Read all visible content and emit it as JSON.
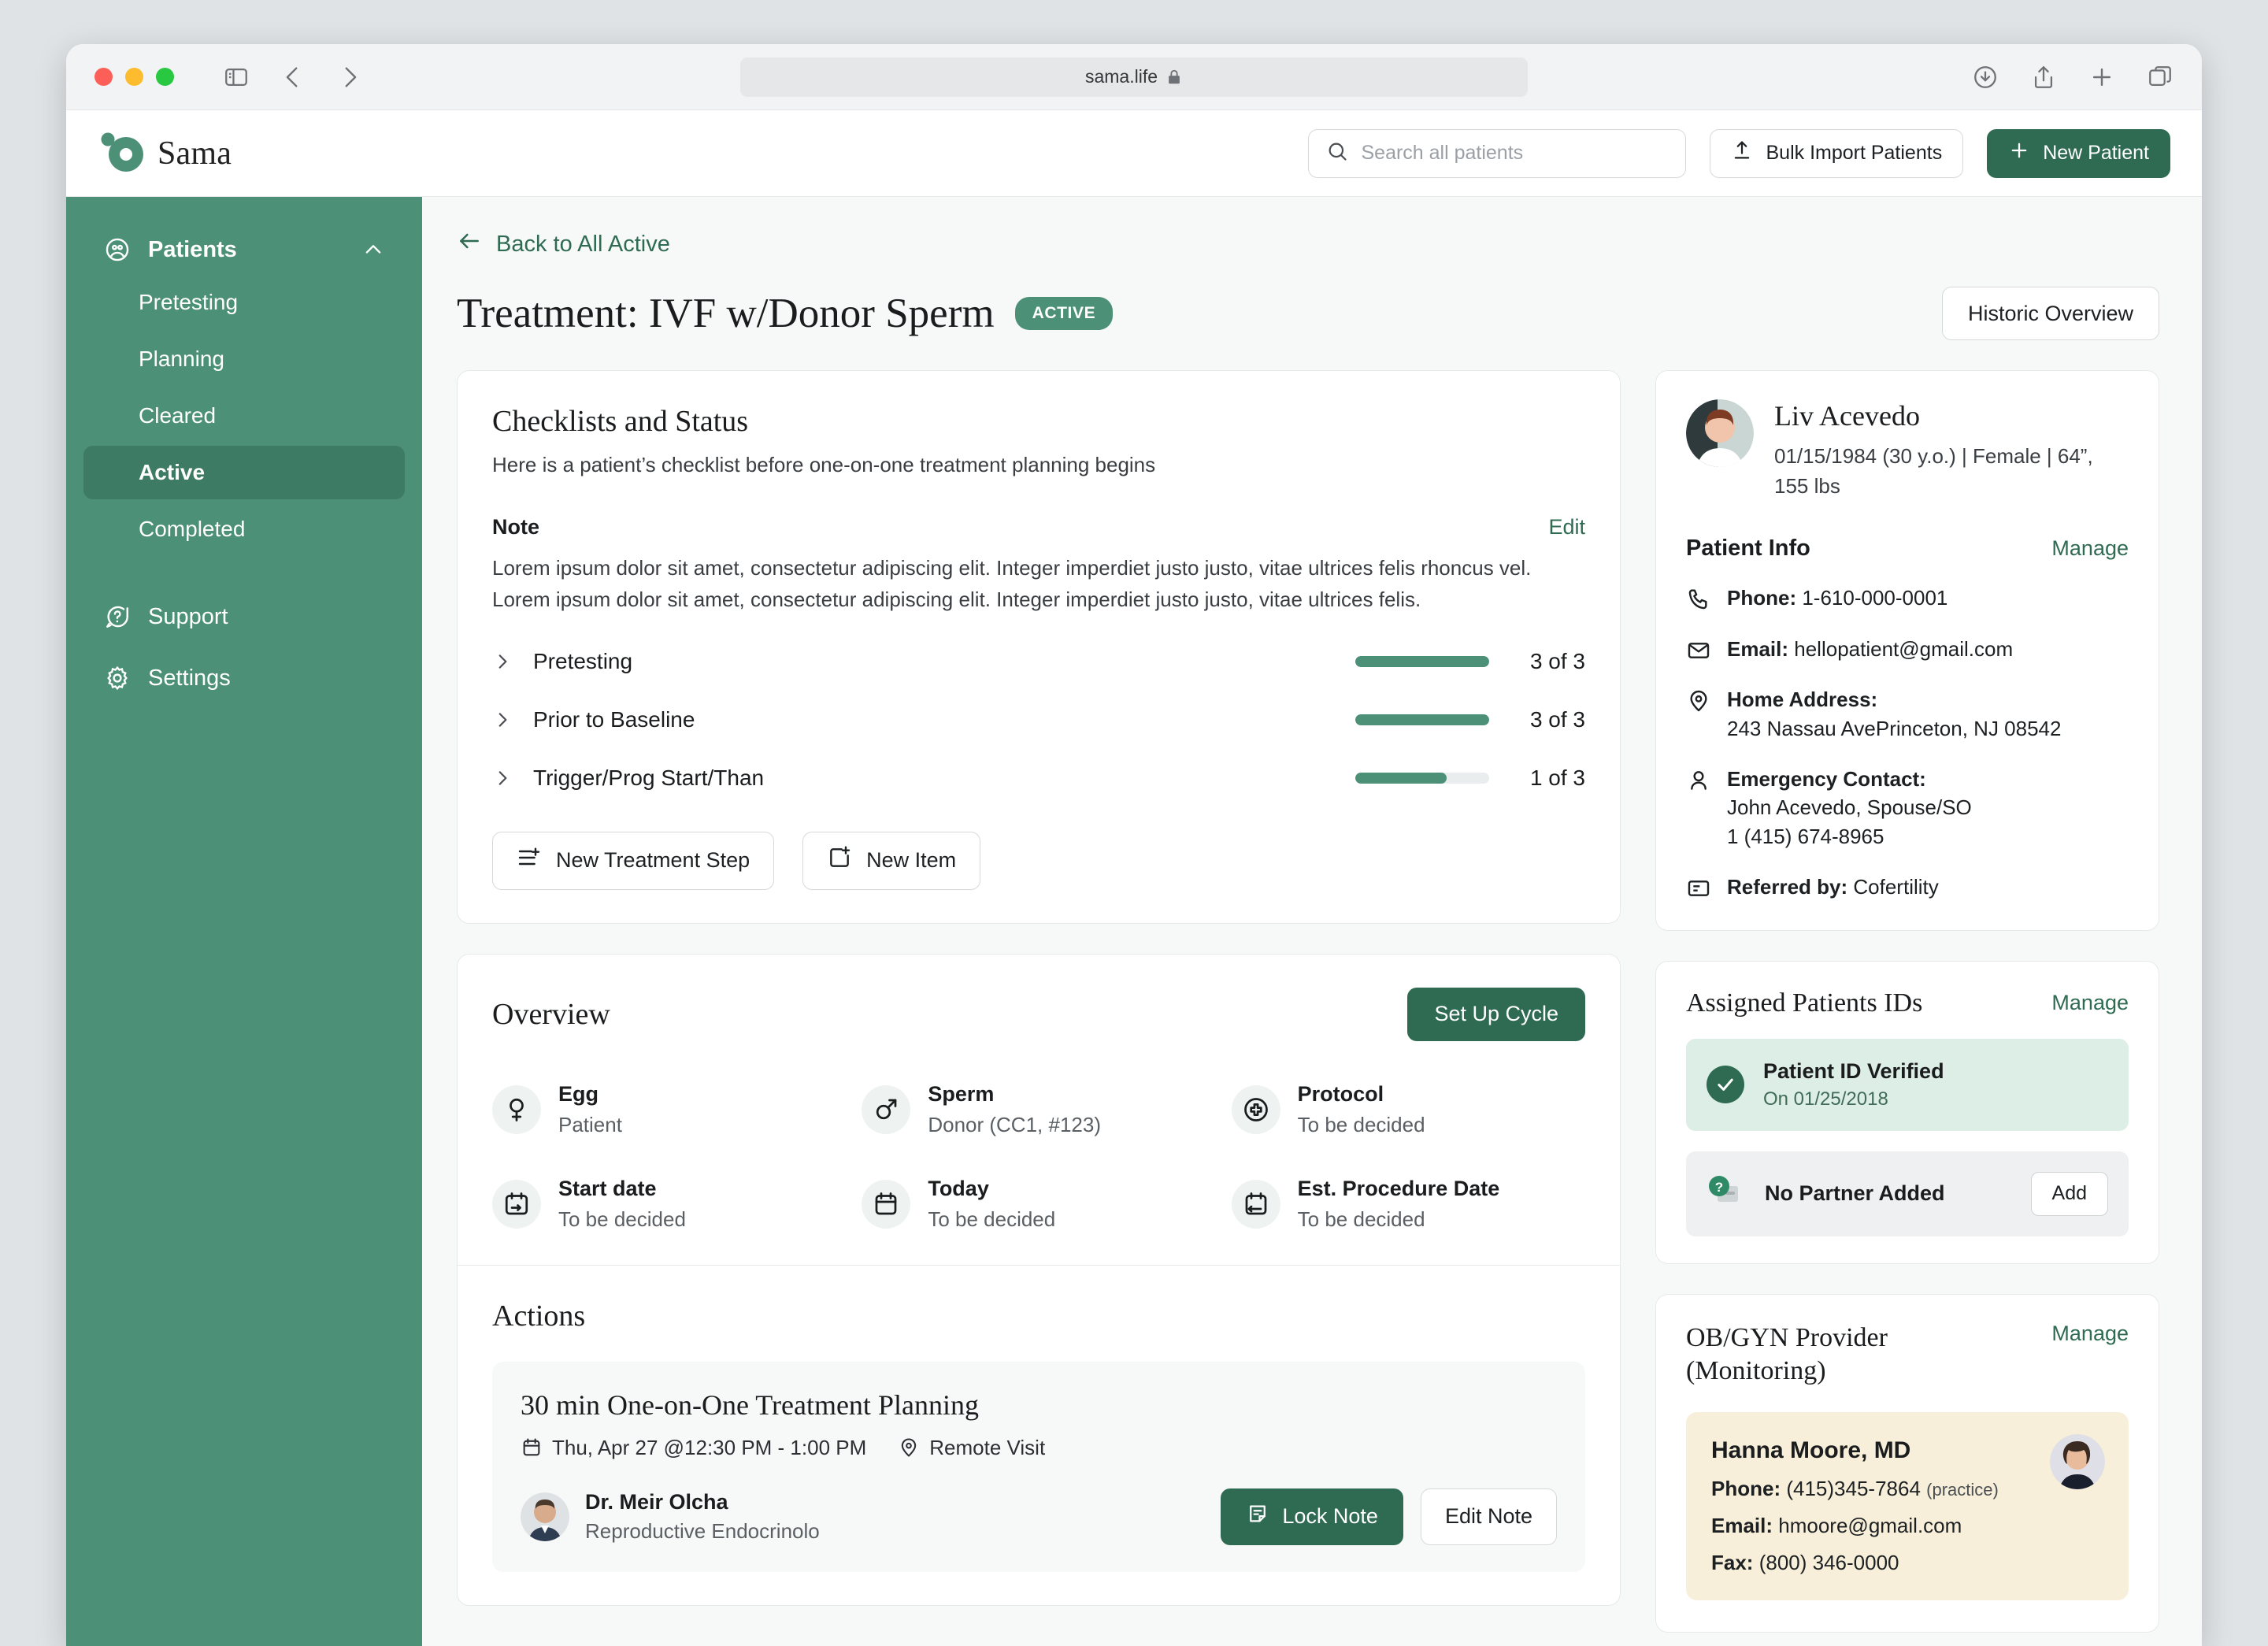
{
  "browser": {
    "url": "sama.life",
    "lock_icon": "lock-icon"
  },
  "app": {
    "brand": "Sama",
    "search": {
      "placeholder": "Search all patients",
      "value": ""
    },
    "bulk_import_label": "Bulk Import Patients",
    "new_patient_label": "New Patient"
  },
  "sidebar": {
    "group": {
      "label": "Patients",
      "icon": "users-icon",
      "chevron": "chevron-up-icon"
    },
    "sub_items": [
      {
        "label": "Pretesting",
        "active": false
      },
      {
        "label": "Planning",
        "active": false
      },
      {
        "label": "Cleared",
        "active": false
      },
      {
        "label": "Active",
        "active": true
      },
      {
        "label": "Completed",
        "active": false
      }
    ],
    "items": [
      {
        "label": "Support",
        "icon": "help-icon"
      },
      {
        "label": "Settings",
        "icon": "gear-icon"
      }
    ]
  },
  "page": {
    "back_label": "Back to All Active",
    "title": "Treatment: IVF w/Donor Sperm",
    "status_badge": "ACTIVE",
    "historic_overview_label": "Historic Overview"
  },
  "checklists": {
    "heading": "Checklists and Status",
    "subheading": "Here is a patient’s checklist before one-on-one treatment planning begins",
    "note_label": "Note",
    "note_edit_label": "Edit",
    "note_body": "Lorem ipsum dolor sit amet, consectetur adipiscing elit. Integer imperdiet justo justo, vitae ultrices felis rhoncus vel. Lorem ipsum dolor sit amet, consectetur adipiscing elit. Integer imperdiet justo justo, vitae ultrices felis.",
    "rows": [
      {
        "label": "Pretesting",
        "count": "3 of 3",
        "percent": 100
      },
      {
        "label": "Prior to Baseline",
        "count": "3 of 3",
        "percent": 100
      },
      {
        "label": "Trigger/Prog Start/Than",
        "count": "1 of 3",
        "percent": 68
      }
    ],
    "new_step_label": "New Treatment Step",
    "new_item_label": "New Item"
  },
  "overview": {
    "heading": "Overview",
    "setup_cycle_label": "Set Up Cycle",
    "items": [
      {
        "icon": "female-icon",
        "label": "Egg",
        "value": "Patient"
      },
      {
        "icon": "male-icon",
        "label": "Sperm",
        "value": "Donor (CC1, #123)"
      },
      {
        "icon": "protocol-icon",
        "label": "Protocol",
        "value": "To be decided"
      },
      {
        "icon": "calendar-start-icon",
        "label": "Start date",
        "value": "To be decided"
      },
      {
        "icon": "calendar-icon",
        "label": "Today",
        "value": "To be decided"
      },
      {
        "icon": "calendar-repeat-icon",
        "label": "Est. Procedure Date",
        "value": "To be decided"
      }
    ]
  },
  "actions": {
    "heading": "Actions",
    "appointment": {
      "title": "30 min One-on-One Treatment Planning",
      "date": "Thu, Apr 27 @12:30 PM - 1:00 PM",
      "location": "Remote Visit",
      "provider_name": "Dr. Meir Olcha",
      "provider_role": "Reproductive Endocrinolo",
      "lock_note_label": "Lock Note",
      "edit_note_label": "Edit Note"
    }
  },
  "patient": {
    "name": "Liv Acevedo",
    "meta": "01/15/1984 (30 y.o.) | Female | 64”, 155 lbs",
    "info_title": "Patient Info",
    "manage_label": "Manage",
    "phone_label": "Phone:",
    "phone_value": "1-610-000-0001",
    "email_label": "Email:",
    "email_value": "hellopatient@gmail.com",
    "address_label": "Home Address:",
    "address_value": "243 Nassau AvePrinceton, NJ 08542",
    "emergency_label": "Emergency Contact:",
    "emergency_name": "John Acevedo, Spouse/SO",
    "emergency_phone": "1 (415) 674-8965",
    "referred_label": "Referred by:",
    "referred_value": "Cofertility"
  },
  "assigned_ids": {
    "title": "Assigned Patients IDs",
    "manage_label": "Manage",
    "verified_title": "Patient ID Verified",
    "verified_sub": "On 01/25/2018",
    "no_partner_title": "No Partner Added",
    "add_label": "Add"
  },
  "obgyn": {
    "title": "OB/GYN Provider (Monitoring)",
    "manage_label": "Manage",
    "name": "Hanna Moore, MD",
    "phone_label": "Phone:",
    "phone_value": "(415)345-7864",
    "phone_note": "(practice)",
    "email_label": "Email:",
    "email_value": "hmoore@gmail.com",
    "fax_label": "Fax:",
    "fax_value": "(800) 346-0000"
  },
  "colors": {
    "brand_green": "#4b9077",
    "dark_green": "#2f6b53",
    "cream": "#f7efd9"
  }
}
